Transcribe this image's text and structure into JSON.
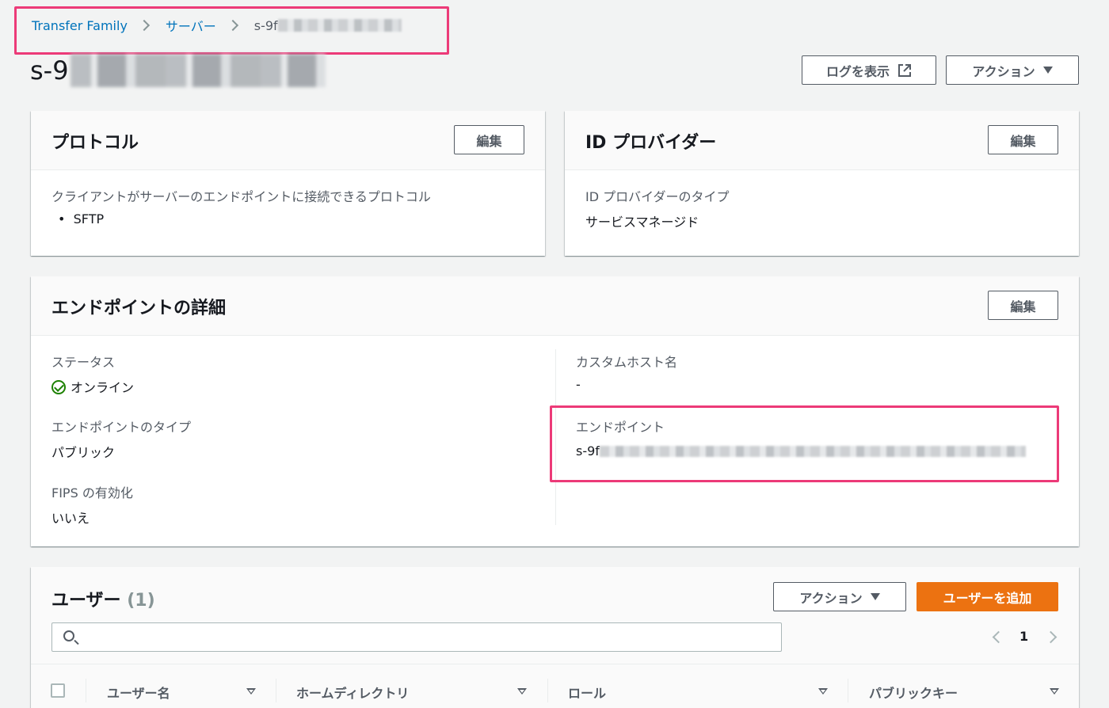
{
  "breadcrumb": {
    "items": [
      "Transfer Family",
      "サーバー"
    ],
    "current": "s-9f"
  },
  "page": {
    "title": "s-9",
    "view_logs_label": "ログを表示",
    "actions_label": "アクション"
  },
  "protocol_panel": {
    "title": "プロトコル",
    "edit_label": "編集",
    "field_label": "クライアントがサーバーのエンドポイントに接続できるプロトコル",
    "protocols": [
      "SFTP"
    ]
  },
  "idp_panel": {
    "title": "ID プロバイダー",
    "edit_label": "編集",
    "field_label": "ID プロバイダーのタイプ",
    "field_value": "サービスマネージド"
  },
  "endpoint_panel": {
    "title": "エンドポイントの詳細",
    "edit_label": "編集",
    "status_label": "ステータス",
    "status_value": "オンライン",
    "endpoint_type_label": "エンドポイントのタイプ",
    "endpoint_type_value": "パブリック",
    "fips_label": "FIPS の有効化",
    "fips_value": "いいえ",
    "custom_host_label": "カスタムホスト名",
    "custom_host_value": "-",
    "endpoint_label": "エンドポイント",
    "endpoint_value": "s-9f"
  },
  "users_panel": {
    "title": "ユーザー",
    "count": "(1)",
    "actions_label": "アクション",
    "add_user_label": "ユーザーを追加",
    "search_placeholder": "",
    "page_number": "1",
    "columns": [
      "ユーザー名",
      "ホームディレクトリ",
      "ロール",
      "パブリックキー"
    ]
  },
  "colors": {
    "link": "#0073bb",
    "primary": "#ec7211",
    "success": "#1d8102",
    "highlight": "#ec3a78"
  }
}
